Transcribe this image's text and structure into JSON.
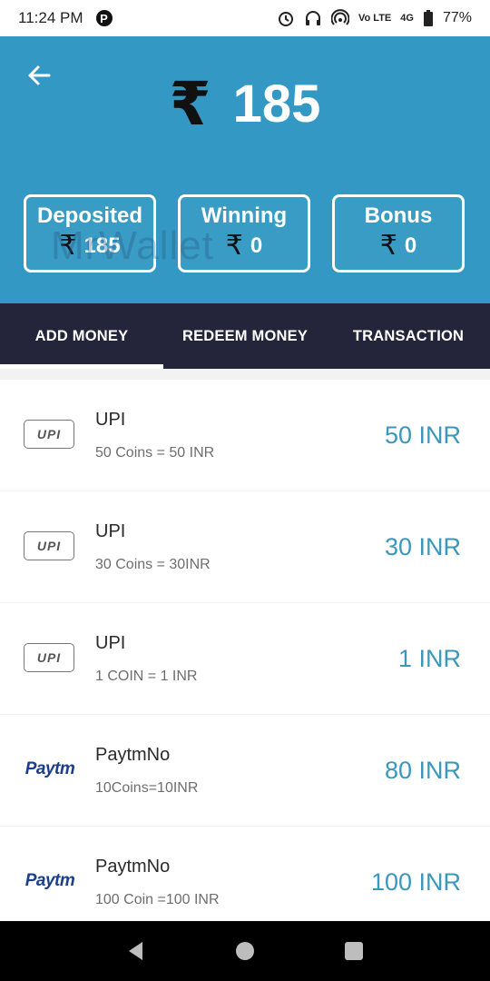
{
  "status_bar": {
    "time": "11:24 PM",
    "p_badge": "P",
    "network": "4G",
    "volte": "Vo LTE",
    "battery": "77%"
  },
  "header": {
    "currency_symbol": "₹",
    "balance": "185",
    "watermark": "MrWallet",
    "cards": [
      {
        "label": "Deposited",
        "symbol": "₹",
        "value": "185"
      },
      {
        "label": "Winning",
        "symbol": "₹",
        "value": "0"
      },
      {
        "label": "Bonus",
        "symbol": "₹",
        "value": "0"
      }
    ]
  },
  "tabs": [
    {
      "label": "ADD MONEY",
      "active": true
    },
    {
      "label": "REDEEM MONEY",
      "active": false
    },
    {
      "label": "TRANSACTION",
      "active": false
    }
  ],
  "offers": [
    {
      "logo": "UPI",
      "title": "UPI",
      "subtitle": "50 Coins = 50 INR",
      "price": "50 INR"
    },
    {
      "logo": "UPI",
      "title": "UPI",
      "subtitle": "30 Coins = 30INR",
      "price": "30 INR"
    },
    {
      "logo": "UPI",
      "title": "UPI",
      "subtitle": "1 COIN = 1 INR",
      "price": "1 INR"
    },
    {
      "logo": "Paytm",
      "title": "PaytmNo",
      "subtitle": "10Coins=10INR",
      "price": "80 INR"
    },
    {
      "logo": "Paytm",
      "title": "PaytmNo",
      "subtitle": "100 Coin =100 INR",
      "price": "100 INR"
    }
  ],
  "colors": {
    "header_bg": "#3399c4",
    "tab_bg": "#24243a",
    "price": "#3a97bd"
  },
  "icons": {
    "back": "arrow-left-icon",
    "nav": [
      "nav-back-icon",
      "nav-home-icon",
      "nav-recents-icon"
    ]
  }
}
